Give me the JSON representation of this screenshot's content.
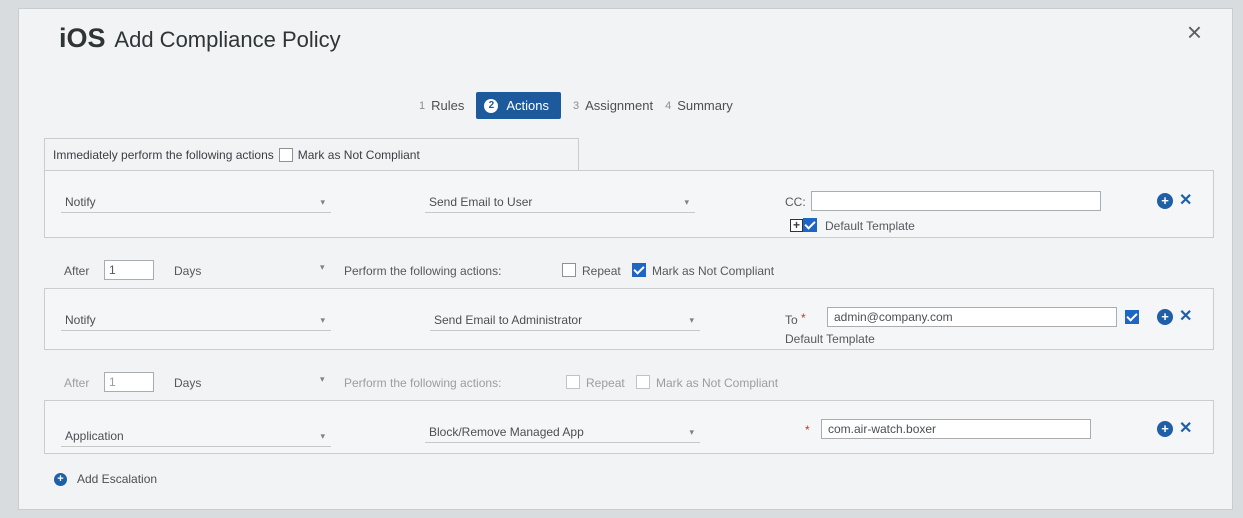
{
  "dialog": {
    "title_prefix": "iOS",
    "title": "Add Compliance Policy",
    "close_glyph": "×"
  },
  "steps": [
    {
      "num": "1",
      "label": "Rules"
    },
    {
      "num": "2",
      "label": "Actions"
    },
    {
      "num": "3",
      "label": "Assignment"
    },
    {
      "num": "4",
      "label": "Summary"
    }
  ],
  "active_step": "Actions",
  "immediate": {
    "text": "Immediately perform the following actions",
    "mark_label": "Mark as Not Compliant",
    "mark_checked": false
  },
  "action1": {
    "type": "Notify",
    "action": "Send Email to User",
    "cc_label": "CC:",
    "cc_value": "",
    "default_template_label": "Default Template",
    "default_template_checked": true
  },
  "escalation1": {
    "after_label": "After",
    "after_value": "1",
    "unit": "Days",
    "perform_text": "Perform the following actions:",
    "repeat_label": "Repeat",
    "repeat_checked": false,
    "mark_label": "Mark as Not Compliant",
    "mark_checked": true
  },
  "action2": {
    "type": "Notify",
    "action": "Send Email to Administrator",
    "to_label": "To",
    "to_value": "admin@company.com",
    "default_template_label": "Default Template"
  },
  "escalation2": {
    "after_label": "After",
    "after_value": "1",
    "unit": "Days",
    "perform_text": "Perform the following actions:",
    "repeat_label": "Repeat",
    "mark_label": "Mark as Not Compliant"
  },
  "action3": {
    "type": "Application",
    "action": "Block/Remove Managed App",
    "app_value": "com.air-watch.boxer"
  },
  "add_escalation_label": "Add Escalation",
  "colors": {
    "accent": "#1d5a9c",
    "check": "#1e66c4"
  }
}
